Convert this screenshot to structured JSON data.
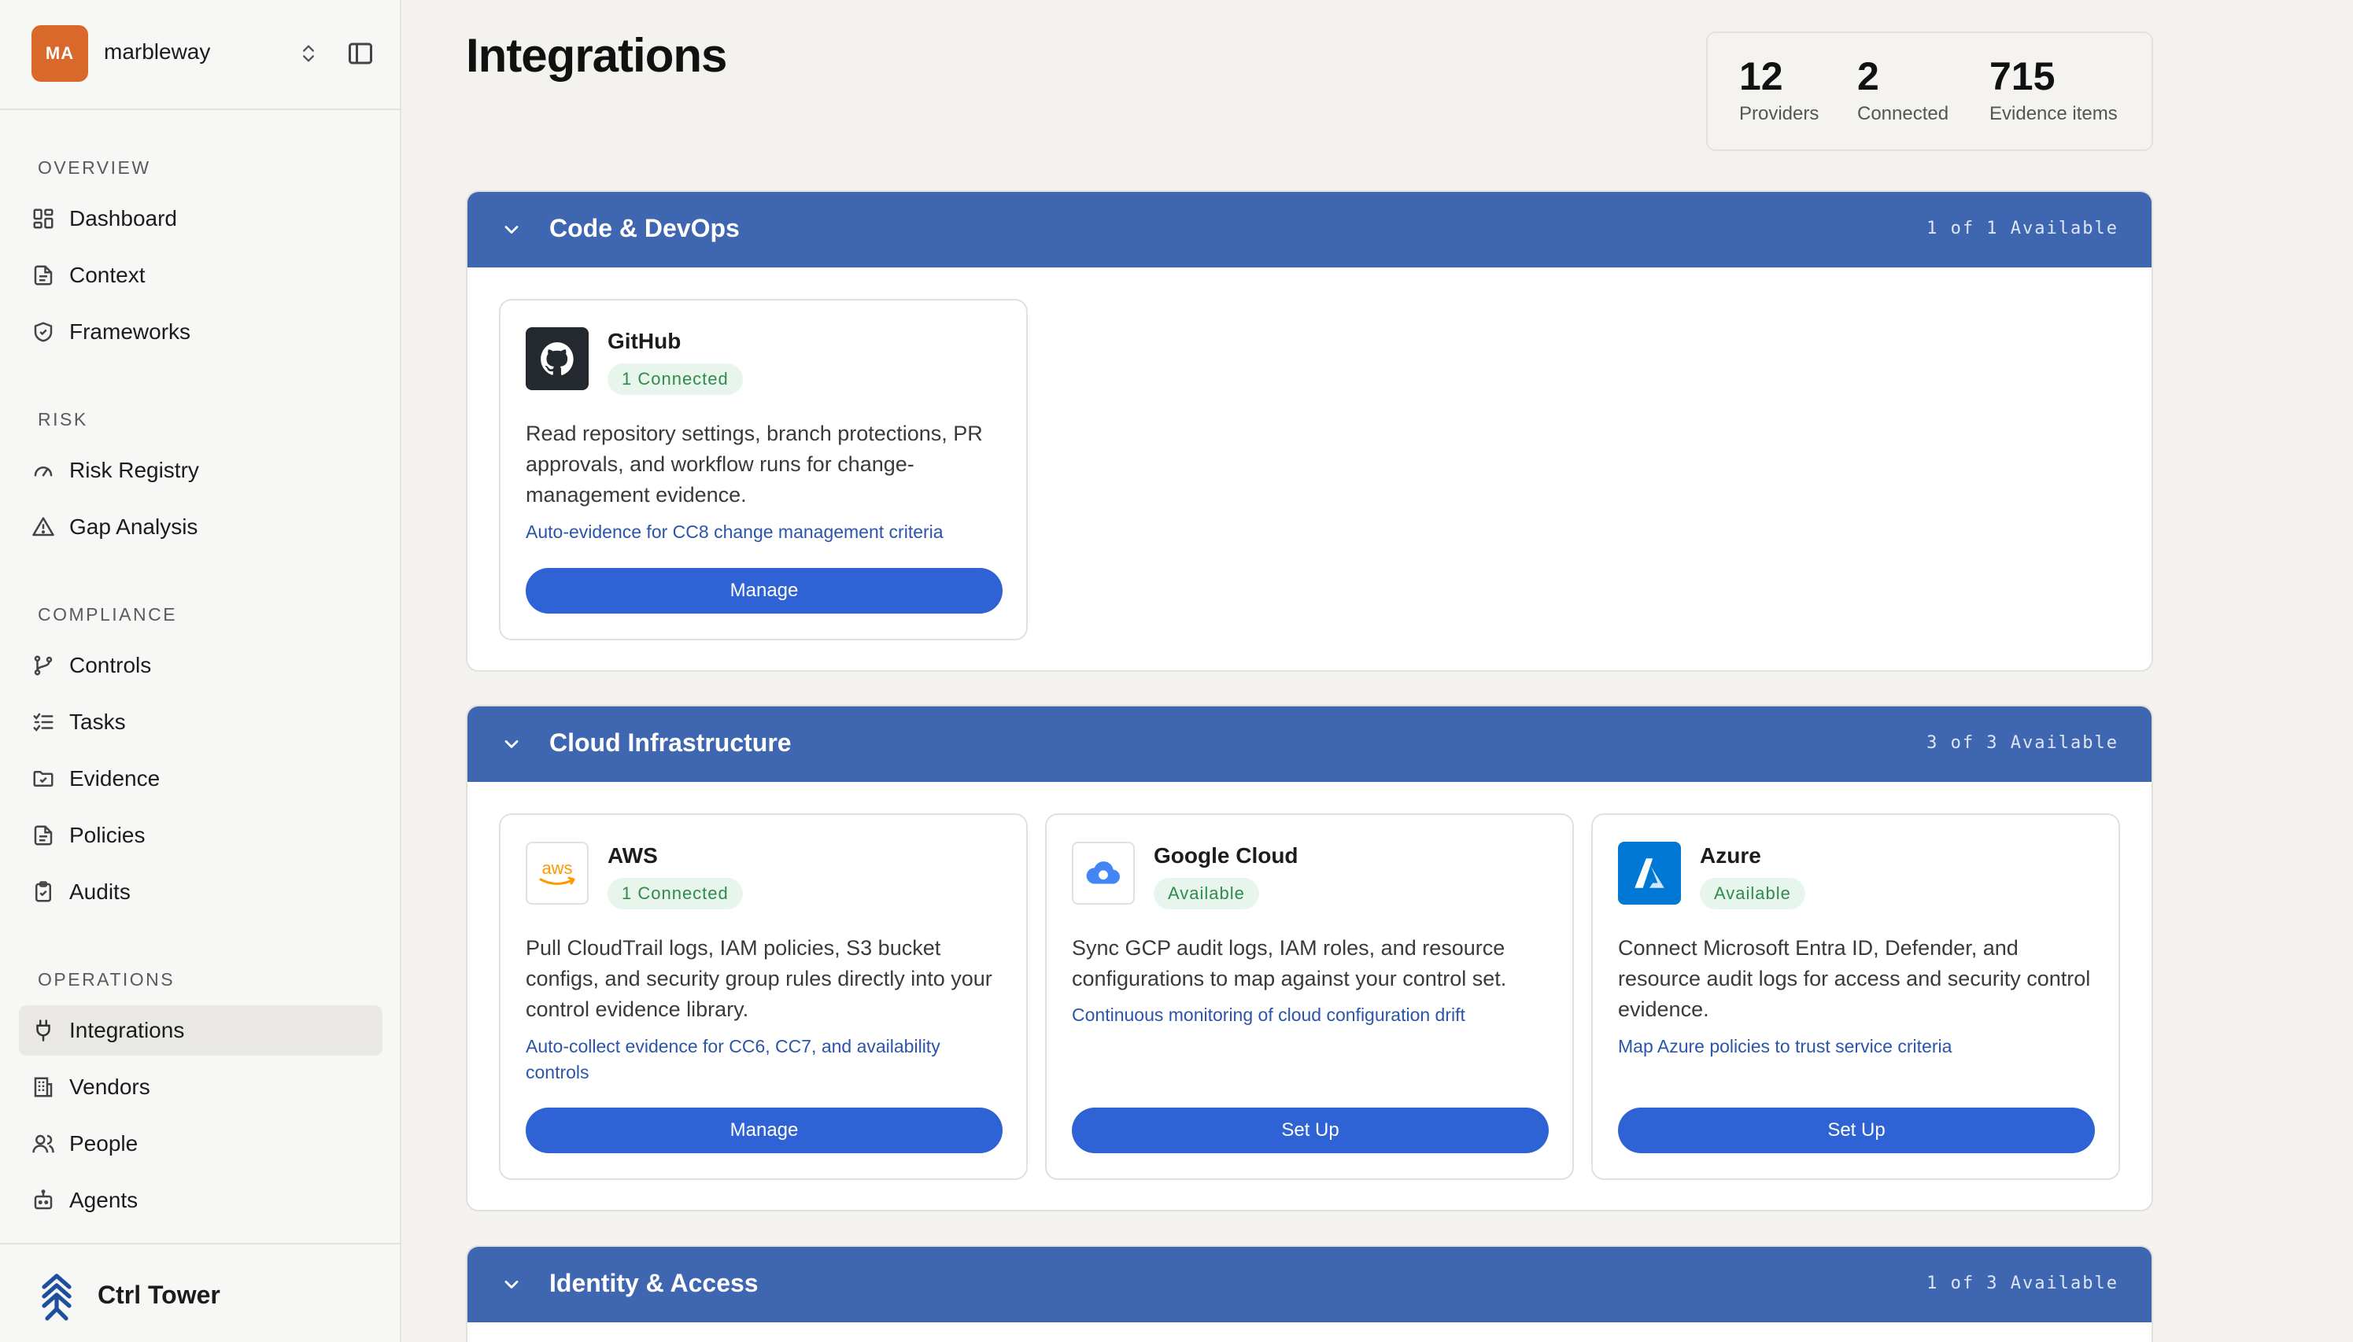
{
  "workspace": {
    "initials": "MA",
    "name": "marbleway"
  },
  "nav": {
    "overview_title": "OVERVIEW",
    "overview": [
      {
        "label": "Dashboard",
        "icon": "dashboard-icon"
      },
      {
        "label": "Context",
        "icon": "document-icon"
      },
      {
        "label": "Frameworks",
        "icon": "shield-icon"
      }
    ],
    "risk_title": "RISK",
    "risk": [
      {
        "label": "Risk Registry",
        "icon": "gauge-icon"
      },
      {
        "label": "Gap Analysis",
        "icon": "warning-icon"
      }
    ],
    "compliance_title": "COMPLIANCE",
    "compliance": [
      {
        "label": "Controls",
        "icon": "branch-icon"
      },
      {
        "label": "Tasks",
        "icon": "checklist-icon"
      },
      {
        "label": "Evidence",
        "icon": "folder-check-icon"
      },
      {
        "label": "Policies",
        "icon": "document-icon"
      },
      {
        "label": "Audits",
        "icon": "clipboard-check-icon"
      }
    ],
    "operations_title": "OPERATIONS",
    "operations": [
      {
        "label": "Integrations",
        "icon": "plug-icon",
        "active": true
      },
      {
        "label": "Vendors",
        "icon": "building-icon"
      },
      {
        "label": "People",
        "icon": "users-icon"
      },
      {
        "label": "Agents",
        "icon": "bot-icon"
      }
    ]
  },
  "brand": {
    "name": "Ctrl Tower"
  },
  "page": {
    "title": "Integrations"
  },
  "stats": [
    {
      "value": "12",
      "label": "Providers"
    },
    {
      "value": "2",
      "label": "Connected"
    },
    {
      "value": "715",
      "label": "Evidence items"
    }
  ],
  "sections": [
    {
      "title": "Code & DevOps",
      "count": "1 of 1 Available",
      "cards": [
        {
          "name": "GitHub",
          "status": "1 Connected",
          "description": "Read repository settings, branch protections, PR approvals, and workflow runs for change-management evidence.",
          "link": "Auto-evidence for CC8 change management criteria",
          "button": "Manage"
        }
      ]
    },
    {
      "title": "Cloud Infrastructure",
      "count": "3 of 3 Available",
      "cards": [
        {
          "name": "AWS",
          "status": "1 Connected",
          "description": "Pull CloudTrail logs, IAM policies, S3 bucket configs, and security group rules directly into your control evidence library.",
          "link": "Auto-collect evidence for CC6, CC7, and availability controls",
          "button": "Manage"
        },
        {
          "name": "Google Cloud",
          "status": "Available",
          "description": "Sync GCP audit logs, IAM roles, and resource configurations to map against your control set.",
          "link": "Continuous monitoring of cloud configuration drift",
          "button": "Set Up"
        },
        {
          "name": "Azure",
          "status": "Available",
          "description": "Connect Microsoft Entra ID, Defender, and resource audit logs for access and security control evidence.",
          "link": "Map Azure policies to trust service criteria",
          "button": "Set Up"
        }
      ]
    },
    {
      "title": "Identity & Access",
      "count": "1 of 3 Available",
      "cards": []
    }
  ],
  "colors": {
    "accent": "#2f62d4",
    "section_header": "#3f66b0",
    "badge_bg": "#e8f5ec",
    "badge_text": "#2f8a4b",
    "avatar": "#d9692a"
  }
}
